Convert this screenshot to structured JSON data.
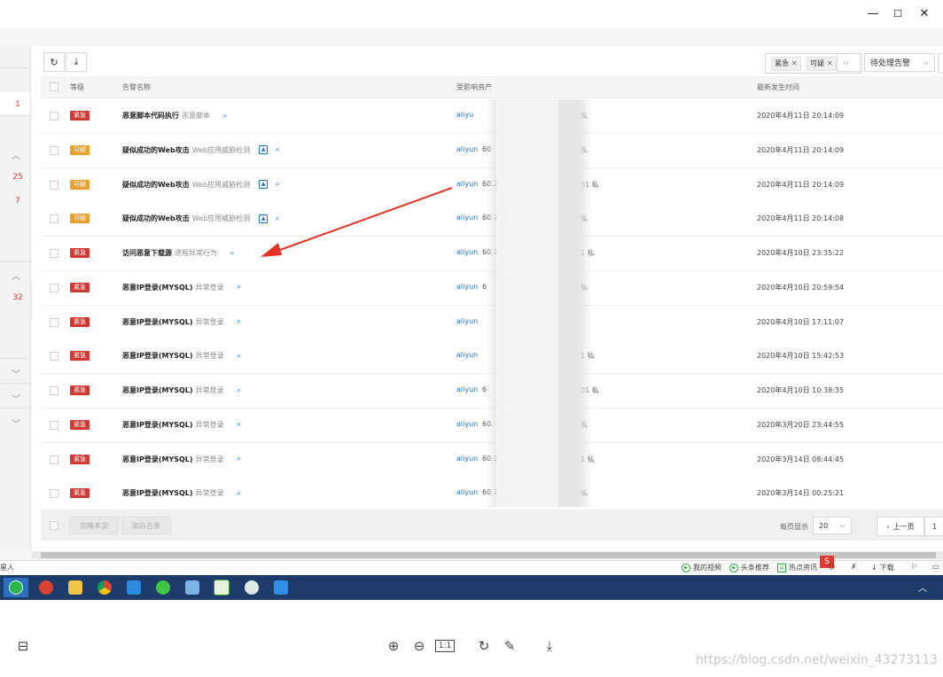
{
  "window": {
    "minimize": "—",
    "maximize": "☐",
    "close": "✕"
  },
  "left_nav": {
    "numbers": [
      {
        "value": "1",
        "top": 0
      },
      {
        "value": "25",
        "top": 0
      },
      {
        "value": "7",
        "top": 0
      },
      {
        "value": "32",
        "top": 0
      }
    ]
  },
  "toolbar": {
    "refresh_icon": "↻",
    "download_icon": "⤓"
  },
  "filters": {
    "tags": [
      "紧急",
      "可疑"
    ],
    "status_select": "待处理告警"
  },
  "table": {
    "headers": {
      "level": "等级",
      "name": "告警名称",
      "asset": "受影响资产",
      "time": "最新发生时间"
    },
    "rows": [
      {
        "level": "紧急",
        "level_color": "#d03a33",
        "name": "恶意脚本代码执行",
        "type": "恶意脚本",
        "has_image_icon": false,
        "asset_prefix": "aliyu",
        "ip": "",
        "ip_suffix": "私",
        "time": "2020年4月11日 20:14:09"
      },
      {
        "level": "可疑",
        "level_color": "#e8a12c",
        "name": "疑似成功的Web攻击",
        "type": "Web应用威胁检测",
        "has_image_icon": true,
        "asset_prefix": "aliyun",
        "ip": "60",
        "ip_suffix": "私",
        "time": "2020年4月11日 20:14:09"
      },
      {
        "level": "可疑",
        "level_color": "#e8a12c",
        "name": "疑似成功的Web攻击",
        "type": "Web应用威胁检测",
        "has_image_icon": true,
        "asset_prefix": "aliyun",
        "ip": "60.20",
        "ip_suffix": "01 私",
        "time": "2020年4月11日 20:14:09"
      },
      {
        "level": "可疑",
        "level_color": "#e8a12c",
        "name": "疑似成功的Web攻击",
        "type": "Web应用威胁检测",
        "has_image_icon": true,
        "asset_prefix": "aliyun",
        "ip": "60.205",
        "ip_suffix": "私",
        "time": "2020年4月11日 20:14:08"
      },
      {
        "level": "紧急",
        "level_color": "#d03a33",
        "name": "访问恶意下载源",
        "type": "进程异常行为",
        "has_image_icon": false,
        "asset_prefix": "aliyun",
        "ip": "60.20",
        "ip_suffix": "1 私",
        "time": "2020年4月10日 23:35:22"
      },
      {
        "level": "紧急",
        "level_color": "#d03a33",
        "name": "恶意IP登录(MYSQL)",
        "type": "异常登录",
        "has_image_icon": false,
        "asset_prefix": "aliyun",
        "ip": "6",
        "ip_suffix": "私",
        "time": "2020年4月10日 20:59:54"
      },
      {
        "level": "紧急",
        "level_color": "#d03a33",
        "name": "恶意IP登录(MYSQL)",
        "type": "异常登录",
        "has_image_icon": false,
        "asset_prefix": "aliyun",
        "ip": "",
        "ip_suffix": "",
        "time": "2020年4月10日 17:11:07"
      },
      {
        "level": "紧急",
        "level_color": "#d03a33",
        "name": "恶意IP登录(MYSQL)",
        "type": "异常登录",
        "has_image_icon": false,
        "asset_prefix": "aliyun",
        "ip": "",
        "ip_suffix": "1 私",
        "time": "2020年4月10日 15:42:53"
      },
      {
        "level": "紧急",
        "level_color": "#d03a33",
        "name": "恶意IP登录(MYSQL)",
        "type": "异常登录",
        "has_image_icon": false,
        "asset_prefix": "aliyun",
        "ip": "6",
        "ip_suffix": "01 私",
        "time": "2020年4月10日 10:38:35"
      },
      {
        "level": "紧急",
        "level_color": "#d03a33",
        "name": "恶意IP登录(MYSQL)",
        "type": "异常登录",
        "has_image_icon": false,
        "asset_prefix": "aliyun",
        "ip": "60.",
        "ip_suffix": "私",
        "time": "2020年3月20日 23:44:55"
      },
      {
        "level": "紧急",
        "level_color": "#d03a33",
        "name": "恶意IP登录(MYSQL)",
        "type": "异常登录",
        "has_image_icon": false,
        "asset_prefix": "aliyun",
        "ip": "60.20",
        "ip_suffix": "1 私",
        "time": "2020年3月14日 08:44:45"
      },
      {
        "level": "紧急",
        "level_color": "#d03a33",
        "name": "恶意IP登录(MYSQL)",
        "type": "异常登录",
        "has_image_icon": false,
        "asset_prefix": "aliyun",
        "ip": "60.2",
        "ip_suffix": "私",
        "time": "2020年3月14日 00:25:21"
      }
    ]
  },
  "footer": {
    "ignore_once": "忽略本次",
    "add_whitelist": "加白名单",
    "per_page_label": "每页显示",
    "per_page_value": "20",
    "prev_page": "上一页",
    "current_page": "1"
  },
  "statusbar": {
    "left_text": "星人",
    "items": [
      "我的视频",
      "头条推荐",
      "热点资讯"
    ],
    "download": "下载"
  },
  "viewer": {
    "zoom_in_icon": "⊕",
    "zoom_out_icon": "⊖",
    "one_to_one": "1:1",
    "rotate_icon": "↻",
    "edit_icon": "✎",
    "download_icon": "⤓",
    "watermark": "https://blog.csdn.net/weixin_43273113"
  }
}
